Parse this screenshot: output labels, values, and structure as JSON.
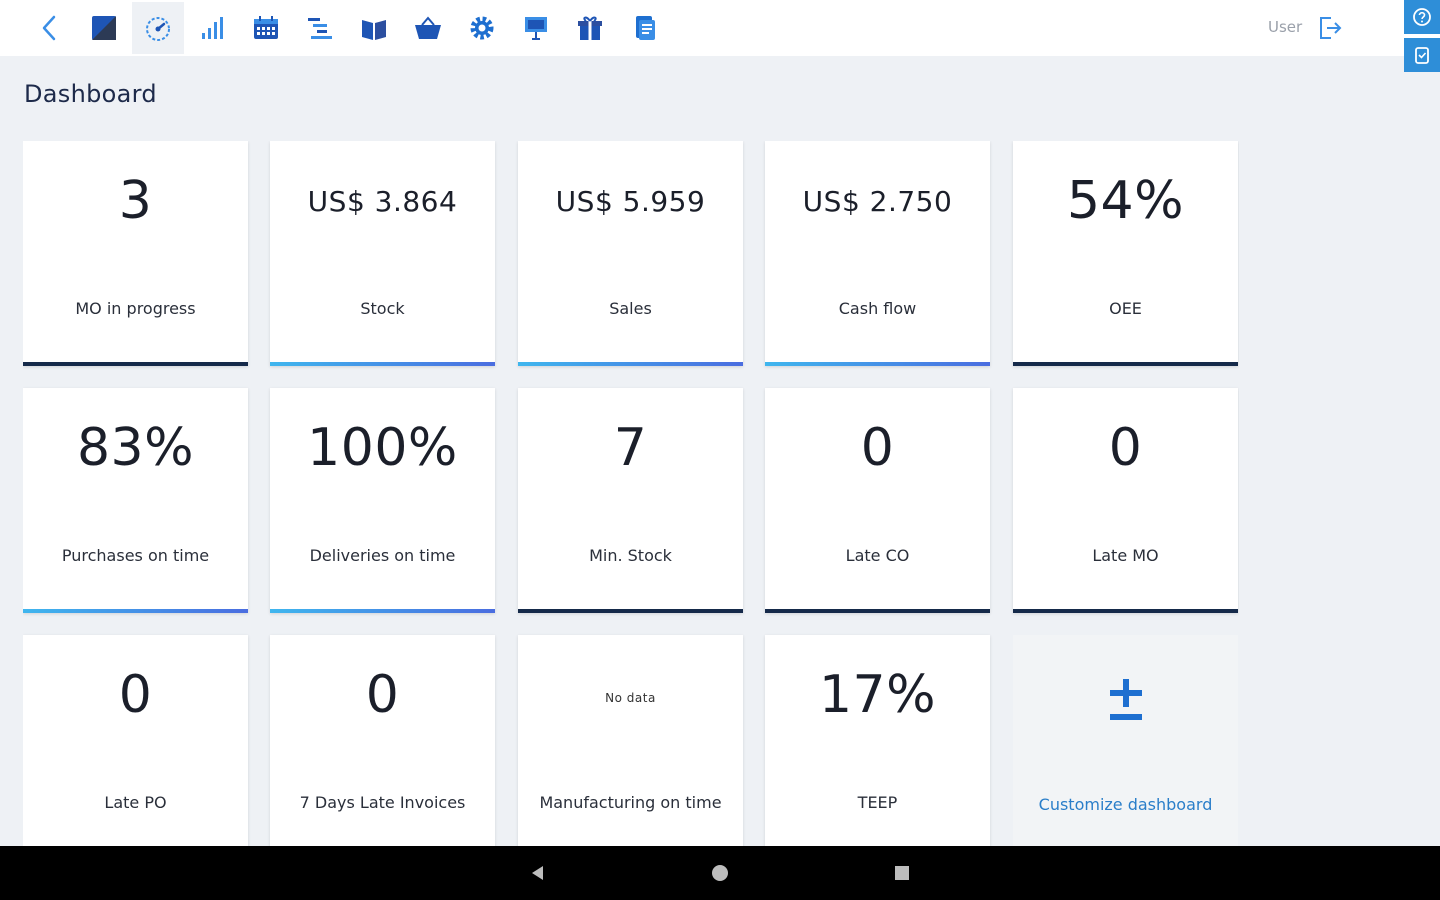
{
  "toolbar": {
    "icons": [
      "back-icon",
      "logo-icon",
      "dashboard-icon",
      "bar-chart-icon",
      "calendar-icon",
      "gantt-icon",
      "book-icon",
      "basket-icon",
      "gear-icon",
      "presentation-icon",
      "gift-icon",
      "document-icon"
    ],
    "active": "dashboard-icon",
    "user_label": "User",
    "accent": "#1e6fd0"
  },
  "page": {
    "title": "Dashboard"
  },
  "cards": [
    {
      "value": "3",
      "label": "MO in progress",
      "bar": "dark"
    },
    {
      "value": "US$ 3.864",
      "label": "Stock",
      "bar": "light"
    },
    {
      "value": "US$ 5.959",
      "label": "Sales",
      "bar": "light"
    },
    {
      "value": "US$ 2.750",
      "label": "Cash flow",
      "bar": "light"
    },
    {
      "value": "54%",
      "label": "OEE",
      "bar": "dark"
    },
    {
      "value": "83%",
      "label": "Purchases on time",
      "bar": "light"
    },
    {
      "value": "100%",
      "label": "Deliveries on time",
      "bar": "light"
    },
    {
      "value": "7",
      "label": "Min. Stock",
      "bar": "dark"
    },
    {
      "value": "0",
      "label": "Late CO",
      "bar": "dark"
    },
    {
      "value": "0",
      "label": "Late MO",
      "bar": "dark"
    },
    {
      "value": "0",
      "label": "Late PO",
      "bar": "none"
    },
    {
      "value": "0",
      "label": "7 Days Late Invoices",
      "bar": "none"
    },
    {
      "value": "No data",
      "label": "Manufacturing on time",
      "bar": "none"
    },
    {
      "value": "17%",
      "label": "TEEP",
      "bar": "none"
    }
  ],
  "customize": {
    "label": "Customize dashboard",
    "icon": "plus-minus-icon"
  },
  "colors": {
    "bar_dark": "#152a4a",
    "bar_light_start": "#3fb6ee",
    "bar_light_end": "#4a6de0",
    "customize_text": "#2a7ec9"
  }
}
